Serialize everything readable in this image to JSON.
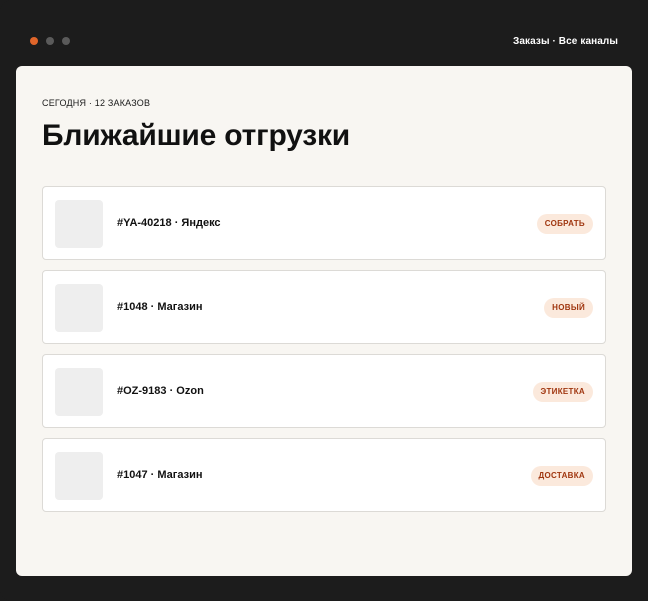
{
  "window": {
    "dots": [
      "close",
      "minimize",
      "maximize"
    ],
    "breadcrumb": "Заказы · Все каналы"
  },
  "main": {
    "meta": "СЕГОДНЯ · 12 ЗАКАЗОВ",
    "title": "Ближайшие отгрузки",
    "orders": [
      {
        "label": "#YA-40218 · Яндекс",
        "status": "СОБРАТЬ"
      },
      {
        "label": "#1048 · Магазин",
        "status": "НОВЫЙ"
      },
      {
        "label": "#OZ-9183 · Ozon",
        "status": "ЭТИКЕТКА"
      },
      {
        "label": "#1047 · Магазин",
        "status": "ДОСТАВКА"
      }
    ]
  },
  "colors": {
    "accent": "#e0652a",
    "badge_bg": "#fbe9dc",
    "badge_text": "#a0360f",
    "frame": "#1c1c1c",
    "surface": "#f8f6f2"
  }
}
